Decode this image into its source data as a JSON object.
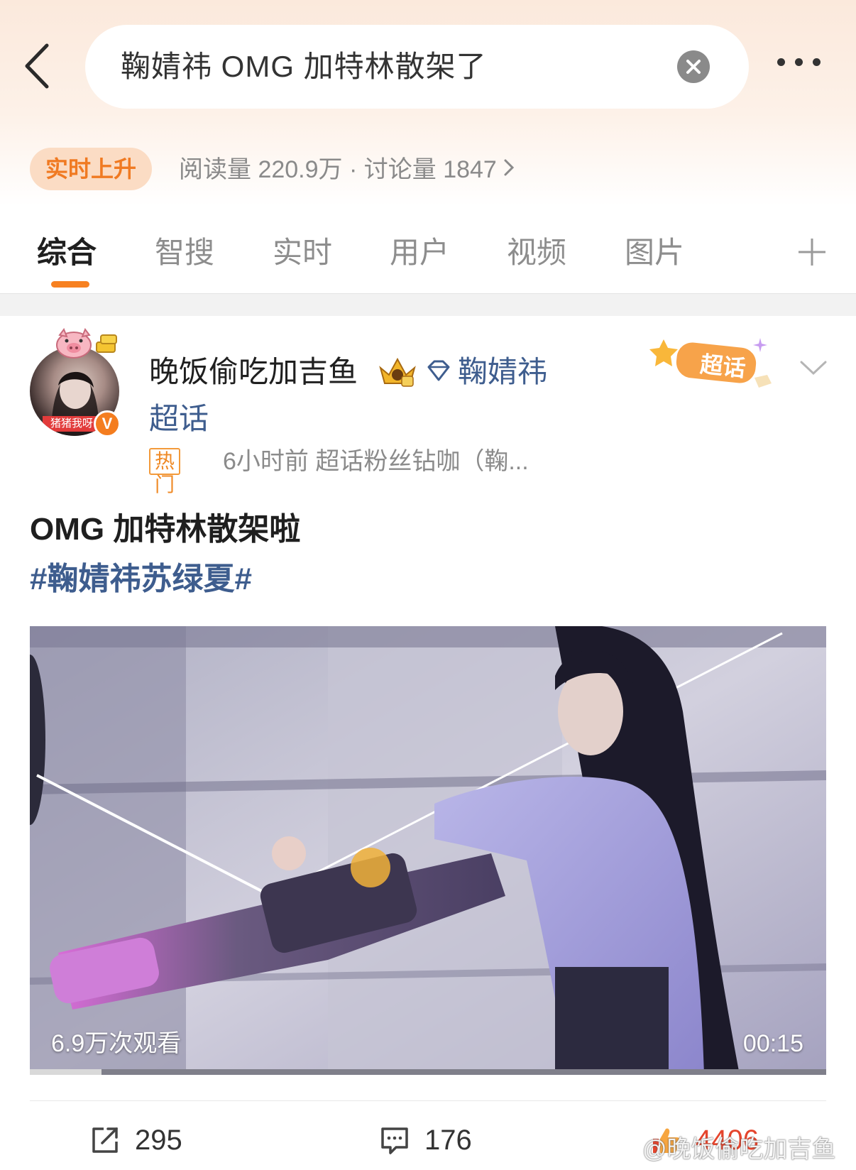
{
  "search": {
    "query": "鞠婧祎 OMG 加特林散架了"
  },
  "trend": {
    "badge": "实时上升",
    "stats": "阅读量 220.9万 · 讨论量 1847"
  },
  "tabs": [
    {
      "label": "综合"
    },
    {
      "label": "智搜"
    },
    {
      "label": "实时"
    },
    {
      "label": "用户"
    },
    {
      "label": "视频"
    },
    {
      "label": "图片"
    }
  ],
  "post": {
    "avatar_tag": "猪猪我呀",
    "verified_mark": "V",
    "username": "晚饭偷吃加吉鱼",
    "topic_name": "鞠婧祎",
    "topic_suffix": "超话",
    "chaohua_badge": "超话",
    "hot_tag": "热门",
    "meta": "6小时前  超话粉丝钻咖（鞠...",
    "title": "OMG 加特林散架啦",
    "hashtag": "#鞠婧祎苏绿夏#",
    "video": {
      "views": "6.9万次观看",
      "duration": "00:15",
      "progress": 0.09
    },
    "actions": {
      "reposts": "295",
      "comments": "176",
      "likes": "4406"
    }
  },
  "watermark": "@晚饭偷吃加吉鱼",
  "colors": {
    "accent": "#f78121",
    "link": "#3e5d8e",
    "like": "#e5452d"
  },
  "icons": [
    "back-arrow-icon",
    "clear-icon",
    "more-icon",
    "plus-icon",
    "chevron-down-icon",
    "repost-icon",
    "comment-icon",
    "like-icon"
  ]
}
